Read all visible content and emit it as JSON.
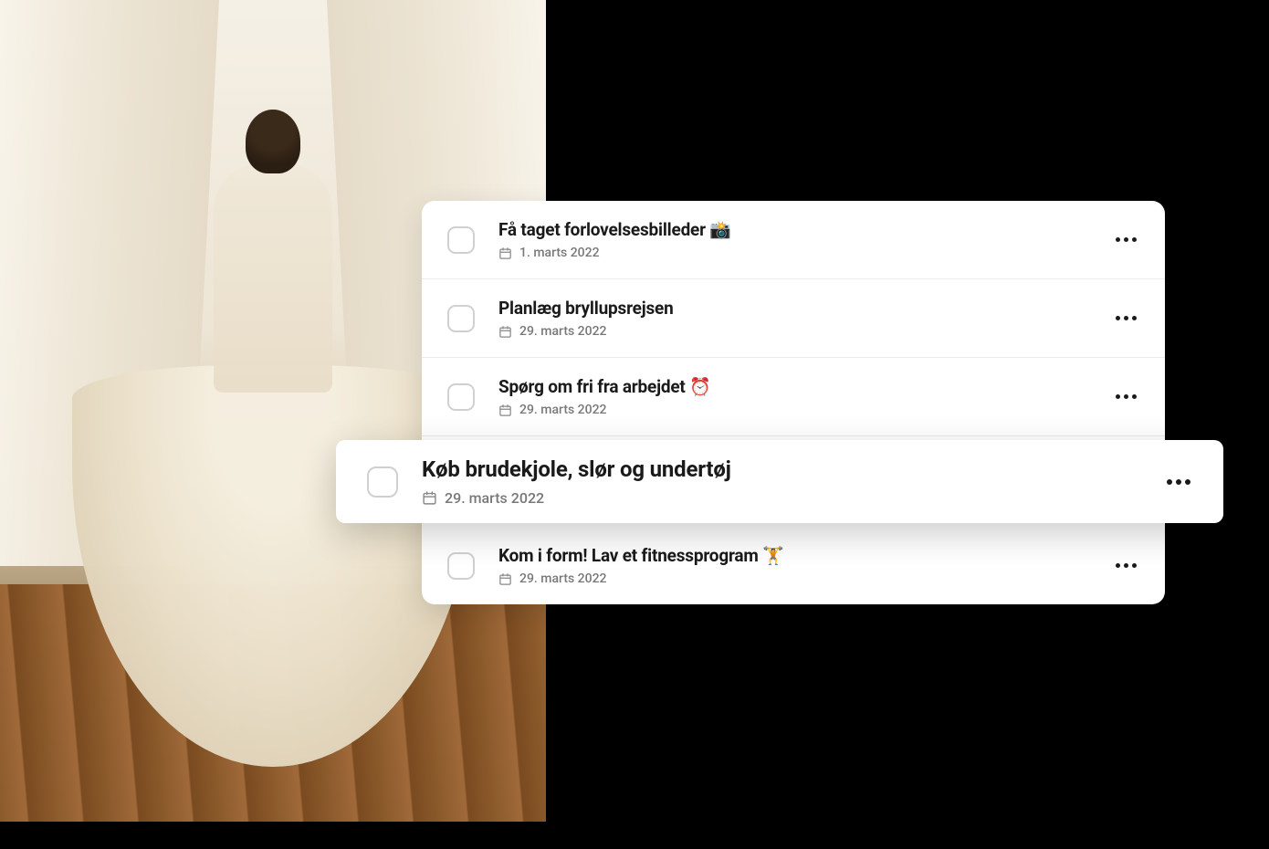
{
  "tasks": [
    {
      "title": "Få taget forlovelsesbilleder 📸",
      "date": "1. marts 2022",
      "highlighted": false
    },
    {
      "title": "Planlæg bryllupsrejsen",
      "date": "29. marts 2022",
      "highlighted": false
    },
    {
      "title": "Spørg om fri fra arbejdet ⏰",
      "date": "29. marts 2022",
      "highlighted": false
    },
    {
      "title": "Køb brudekjole, slør og undertøj",
      "date": "29. marts 2022",
      "highlighted": true
    },
    {
      "title": "Kom i form! Lav et fitnessprogram 🏋️",
      "date": "29. marts 2022",
      "highlighted": false
    }
  ]
}
